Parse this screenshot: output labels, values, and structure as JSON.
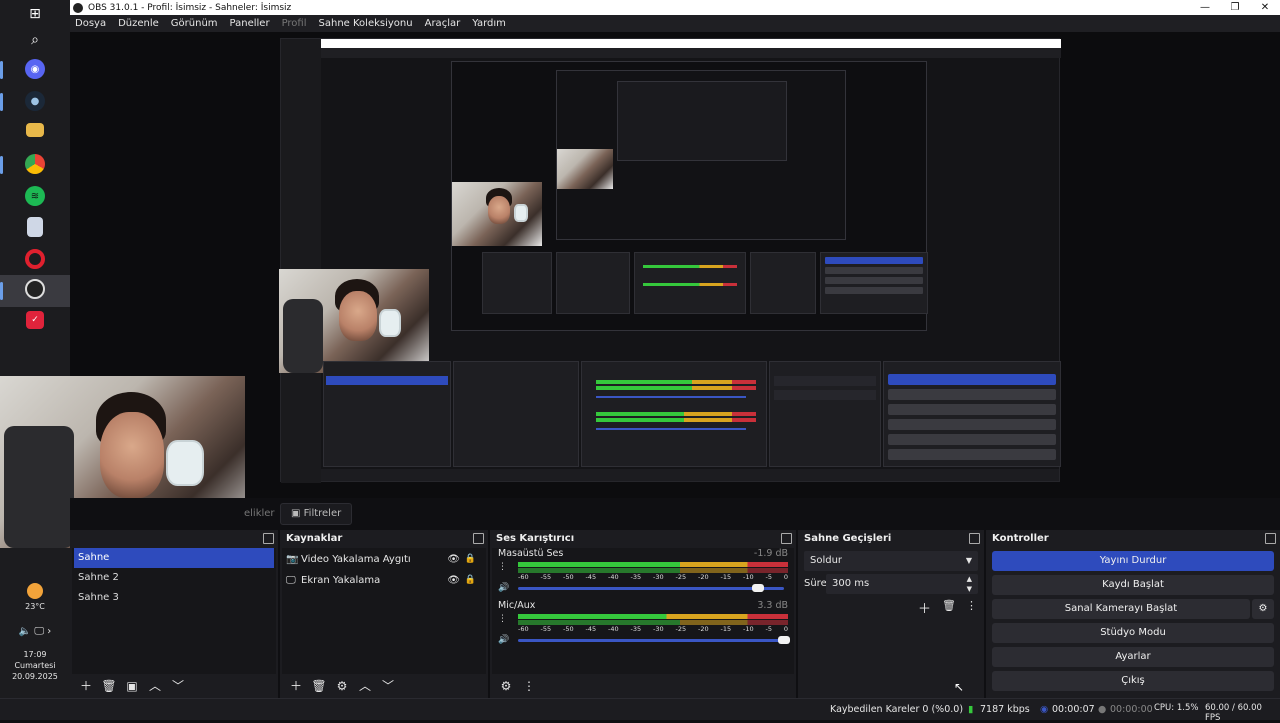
{
  "window": {
    "title": "OBS 31.0.1 - Profil: İsimsiz - Sahneler: İsimsiz",
    "min": "—",
    "restore": "❐",
    "close": "✕"
  },
  "menu": [
    "Dosya",
    "Düzenle",
    "Görünüm",
    "Paneller",
    "Profil",
    "Sahne Koleksiyonu",
    "Araçlar",
    "Yardım"
  ],
  "taskbar": {
    "weather_temp": "23°C",
    "time": "17:09",
    "day": "Cumartesi",
    "date": "20.09.2025",
    "icons": [
      "windows-icon",
      "search-icon",
      "discord-icon",
      "steam-icon",
      "file-explorer-icon",
      "chrome-icon",
      "spotify-icon",
      "calculator-icon",
      "opera-icon",
      "obs-icon",
      "app-icon"
    ]
  },
  "tabs": {
    "properties": "Özellikler",
    "properties_visible": "elikler",
    "filters": "Filtreler"
  },
  "scenes": {
    "title": "Sahneler",
    "items": [
      "Sahne",
      "Sahne 2",
      "Sahne 3"
    ]
  },
  "sources": {
    "title": "Kaynaklar",
    "items": [
      "Video Yakalama Aygıtı",
      "Ekran Yakalama"
    ]
  },
  "mixer": {
    "title": "Ses Karıştırıcı",
    "channels": [
      {
        "name": "Masaüstü Ses",
        "db": "-1.9 dB",
        "volume": 0.95
      },
      {
        "name": "Mic/Aux",
        "db": "3.3 dB",
        "volume": 1.0
      }
    ],
    "ticks": [
      "-60",
      "-55",
      "-50",
      "-45",
      "-40",
      "-35",
      "-30",
      "-25",
      "-20",
      "-15",
      "-10",
      "-5",
      "0"
    ]
  },
  "transitions": {
    "title": "Sahne Geçişleri",
    "selected": "Soldur",
    "duration_label": "Süre",
    "duration_value": "300 ms"
  },
  "controls": {
    "title": "Kontroller",
    "buttons": [
      "Yayını Durdur",
      "Kaydı Başlat",
      "Sanal Kamerayı Başlat",
      "Stüdyo Modu",
      "Ayarlar",
      "Çıkış"
    ]
  },
  "status": {
    "dropped": "Kaybedilen Kareler 0 (%0.0)",
    "bitrate": "7187 kbps",
    "stream_time": "00:00:07",
    "rec_time": "00:00:00",
    "cpu": "CPU: 1.5%",
    "fps": "60.00 / 60.00 FPS"
  },
  "colors": {
    "accent": "#2e4bbd",
    "meter_green": "#35c83c",
    "meter_yellow": "#d8a41f",
    "meter_red": "#c9303a"
  }
}
